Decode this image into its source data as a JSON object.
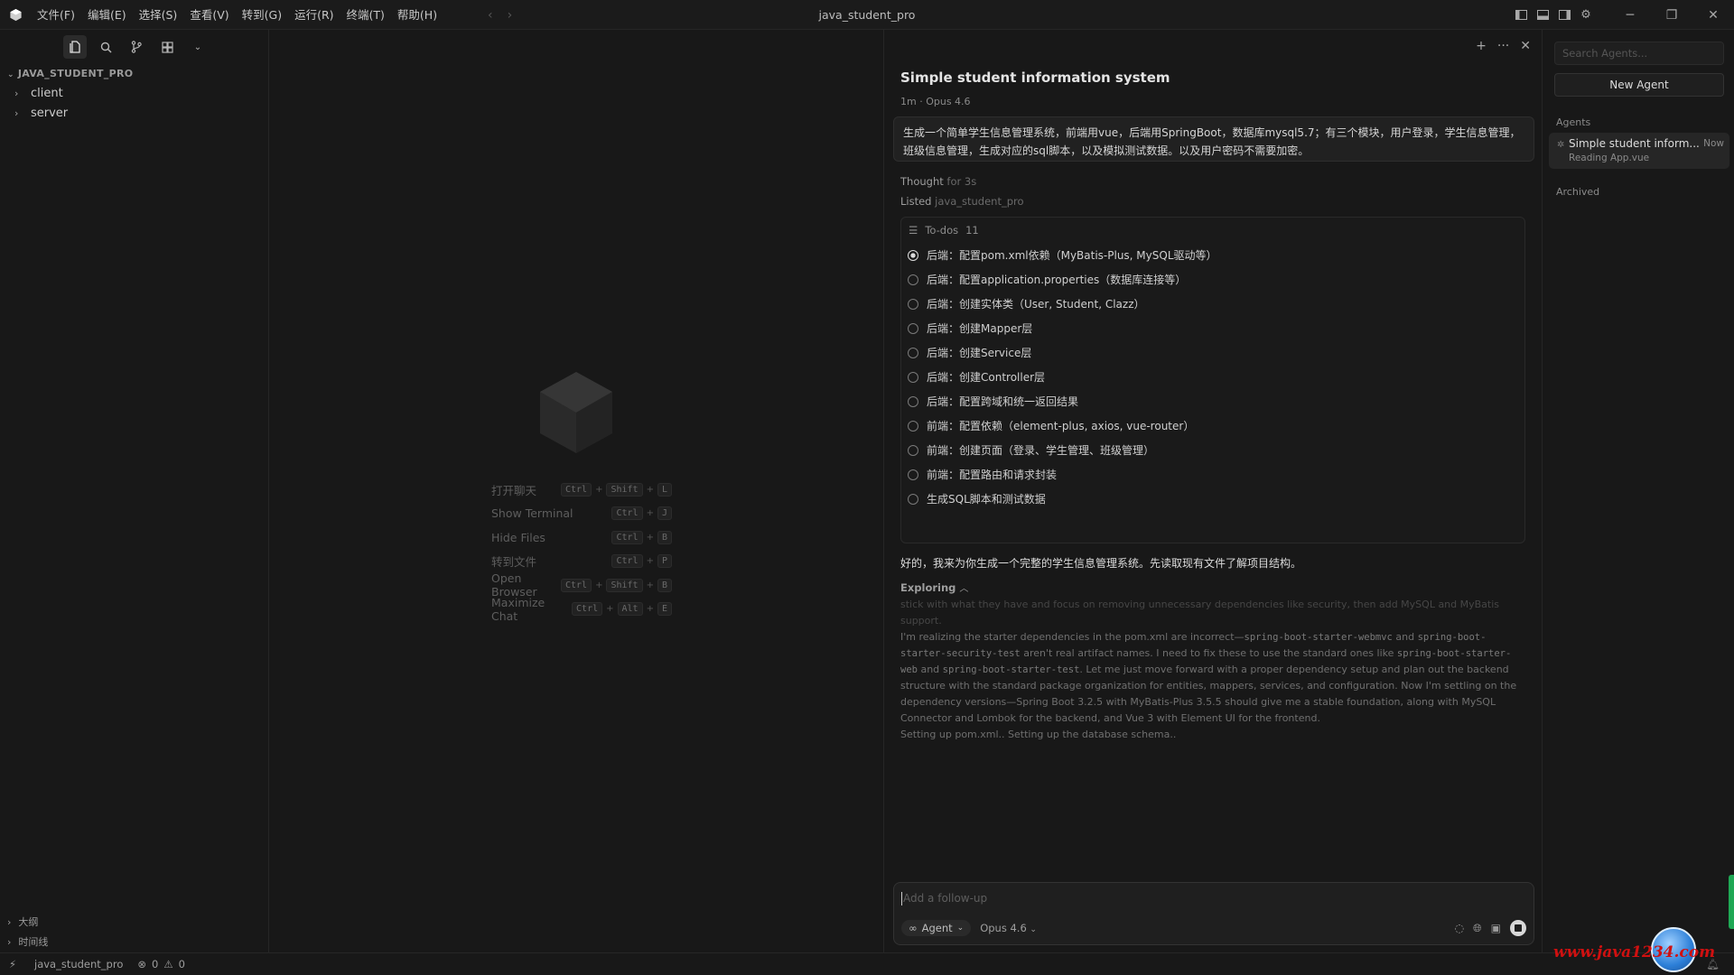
{
  "titlebar": {
    "menu": [
      "文件(F)",
      "编辑(E)",
      "选择(S)",
      "查看(V)",
      "转到(G)",
      "运行(R)",
      "终端(T)",
      "帮助(H)"
    ],
    "window_title": "java_student_pro"
  },
  "sidebar": {
    "project_name": "JAVA_STUDENT_PRO",
    "tree": [
      {
        "label": "client"
      },
      {
        "label": "server"
      }
    ],
    "bottom_sections": [
      "大纲",
      "时间线"
    ]
  },
  "editor": {
    "shortcuts": [
      {
        "label": "打开聊天",
        "keys": [
          "Ctrl",
          "Shift",
          "L"
        ]
      },
      {
        "label": "Show Terminal",
        "keys": [
          "Ctrl",
          "J"
        ]
      },
      {
        "label": "Hide Files",
        "keys": [
          "Ctrl",
          "B"
        ]
      },
      {
        "label": "转到文件",
        "keys": [
          "Ctrl",
          "P"
        ]
      },
      {
        "label": "Open Browser",
        "keys": [
          "Ctrl",
          "Shift",
          "B"
        ]
      },
      {
        "label": "Maximize Chat",
        "keys": [
          "Ctrl",
          "Alt",
          "E"
        ]
      }
    ]
  },
  "chat": {
    "title": "Simple student information system",
    "meta": "1m · Opus 4.6",
    "prompt": "生成一个简单学生信息管理系统，前端用vue，后端用SpringBoot，数据库mysql5.7；有三个模块，用户登录，学生信息管理，班级信息管理，生成对应的sql脚本，以及模拟测试数据。以及用户密码不需要加密。",
    "thought_label": "Thought",
    "thought_time": "for 3s",
    "listed_label": "Listed",
    "listed_target": "java_student_pro",
    "todos_label": "To-dos",
    "todos_count": "11",
    "todos": [
      {
        "text": "后端：配置pom.xml依赖（MyBatis-Plus, MySQL驱动等）",
        "active": true
      },
      {
        "text": "后端：配置application.properties（数据库连接等）",
        "active": false
      },
      {
        "text": "后端：创建实体类（User, Student, Clazz）",
        "active": false
      },
      {
        "text": "后端：创建Mapper层",
        "active": false
      },
      {
        "text": "后端：创建Service层",
        "active": false
      },
      {
        "text": "后端：创建Controller层",
        "active": false
      },
      {
        "text": "后端：配置跨域和统一返回结果",
        "active": false
      },
      {
        "text": "前端：配置依赖（element-plus, axios, vue-router）",
        "active": false
      },
      {
        "text": "前端：创建页面（登录、学生管理、班级管理）",
        "active": false
      },
      {
        "text": "前端：配置路由和请求封装",
        "active": false
      },
      {
        "text": "生成SQL脚本和测试数据",
        "active": false
      }
    ],
    "reply": "好的，我来为你生成一个完整的学生信息管理系统。先读取现有文件了解项目结构。",
    "exploring_label": "Exploring",
    "explore_faint": "stick with what they have and focus on removing unnecessary dependencies like security, then add MySQL and MyBatis support.",
    "explore_p1_a": "I'm realizing the starter dependencies in the pom.xml are incorrect—",
    "explore_code1": "spring-boot-starter-webmvc",
    "explore_p1_b": " and ",
    "explore_code2": "spring-boot-starter-security-test",
    "explore_p1_c": " aren't real artifact names. I need to fix these to use the standard ones like ",
    "explore_code3": "spring-boot-starter-web",
    "explore_p1_d": " and ",
    "explore_code4": "spring-boot-starter-test",
    "explore_p1_e": ". Let me just move forward with a proper dependency setup and plan out the backend structure with the standard package organization for entities, mappers, services, and configuration. Now I'm settling on the dependency versions—Spring Boot 3.2.5 with MyBatis-Plus 3.5.5 should give me a stable foundation, along with MySQL Connector and Lombok for the backend, and Vue 3 with Element UI for the frontend.",
    "explore_p2": "Setting up pom.xml.. Setting up the database schema..",
    "input_placeholder": "Add a follow-up",
    "mode_label": "Agent",
    "model_label": "Opus 4.6"
  },
  "agents": {
    "search_placeholder": "Search Agents...",
    "new_agent_label": "New Agent",
    "section_label": "Agents",
    "items": [
      {
        "name": "Simple student inform...",
        "status": "Reading App.vue",
        "time": "Now"
      }
    ],
    "archived_label": "Archived"
  },
  "statusbar": {
    "branch": "java_student_pro",
    "errors": "0",
    "warnings": "0"
  },
  "overlay": {
    "site_watermark": "www.java1234.com"
  }
}
